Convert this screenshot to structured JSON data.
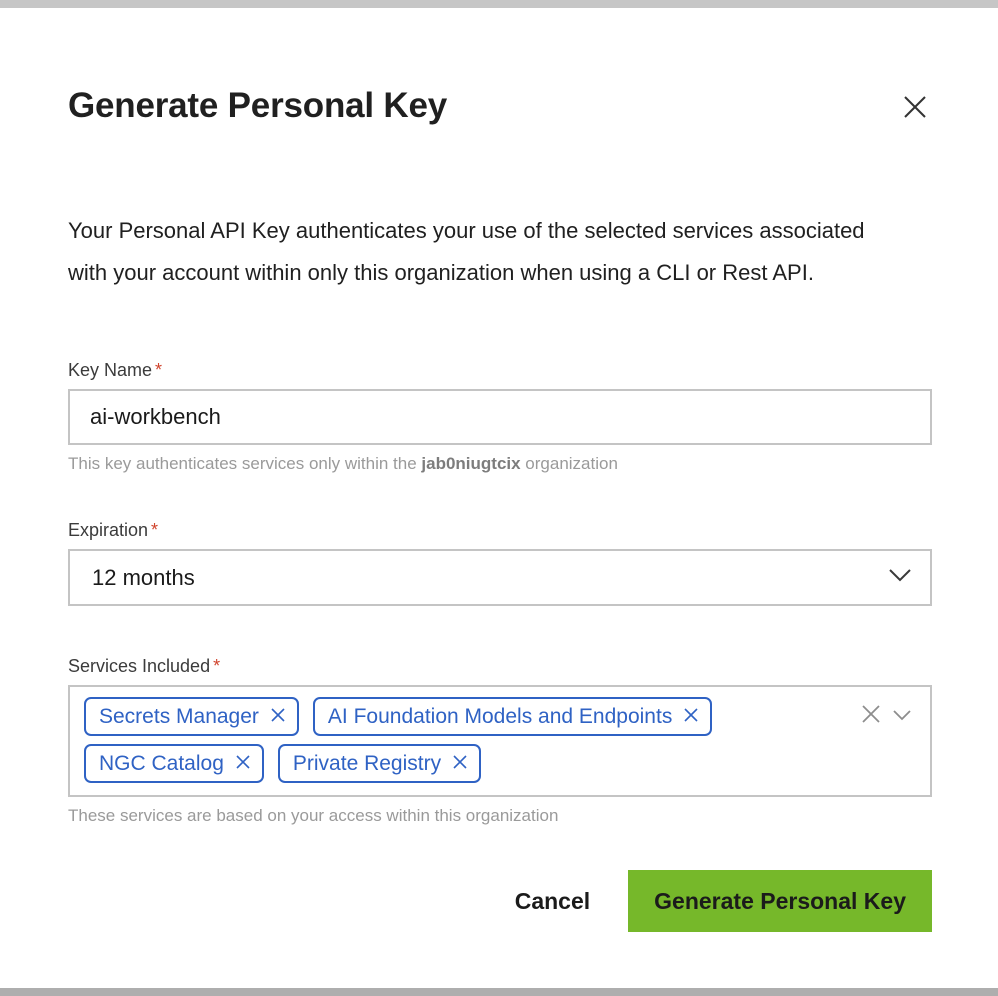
{
  "dialog": {
    "title": "Generate Personal Key",
    "close_icon": "close-icon",
    "description": "Your Personal API Key authenticates your use of the selected services associated with your account within only this organization when using a CLI or Rest API."
  },
  "key_name": {
    "label": "Key Name",
    "required_marker": "*",
    "value": "ai-workbench",
    "placeholder": "",
    "helper_prefix": "This key authenticates services only within the ",
    "helper_org": "jab0niugtcix",
    "helper_suffix": " organization"
  },
  "expiration": {
    "label": "Expiration",
    "required_marker": "*",
    "value": "12 months",
    "chevron_icon": "chevron-down-icon"
  },
  "services": {
    "label": "Services Included",
    "required_marker": "*",
    "chips": [
      {
        "label": "Secrets Manager",
        "remove_icon": "close-icon"
      },
      {
        "label": "AI Foundation Models and Endpoints",
        "remove_icon": "close-icon"
      },
      {
        "label": "NGC Catalog",
        "remove_icon": "close-icon"
      },
      {
        "label": "Private Registry",
        "remove_icon": "close-icon"
      }
    ],
    "clear_all_icon": "close-icon",
    "chevron_icon": "chevron-down-icon",
    "helper": "These services are based on your access within this organization"
  },
  "footer": {
    "cancel_label": "Cancel",
    "submit_label": "Generate Personal Key"
  },
  "colors": {
    "accent_green": "#76b82a",
    "chip_blue": "#2f62c4",
    "required_red": "#d0432c",
    "border_gray": "#c4c4c4",
    "edge_gray": "#c6c6c6"
  }
}
